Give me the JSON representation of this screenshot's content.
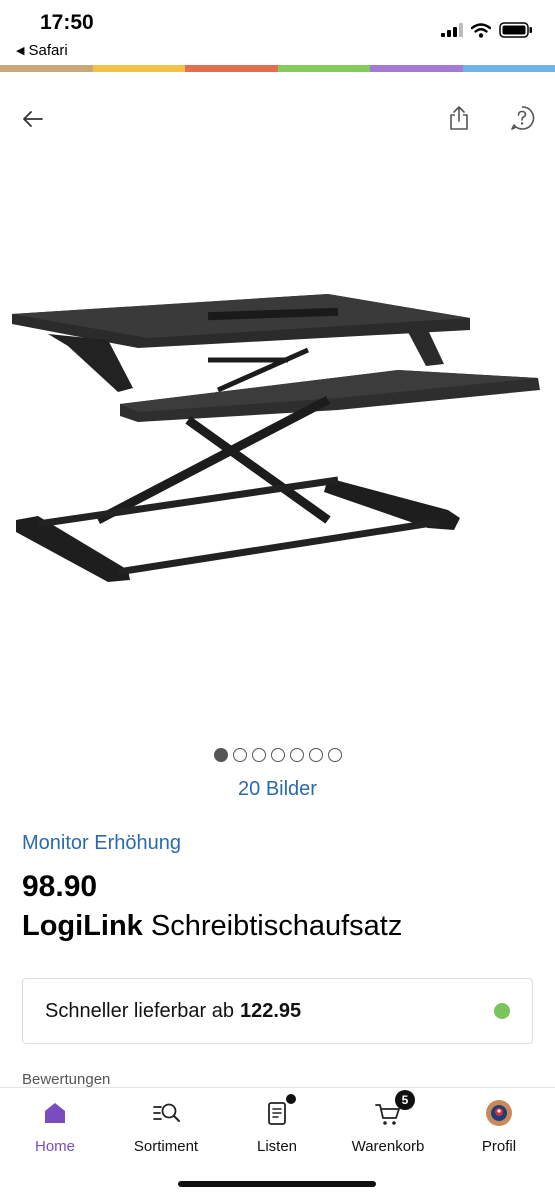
{
  "status_bar": {
    "time": "17:50",
    "back_app": "Safari"
  },
  "color_stripe": [
    "#c9a87c",
    "#f0c24a",
    "#e0704f",
    "#86c95d",
    "#a57bd1",
    "#6fb3e8"
  ],
  "header": {
    "back_icon": "arrow-left-icon",
    "share_icon": "share-icon",
    "help_icon": "help-icon"
  },
  "gallery": {
    "dot_count": 7,
    "active_dot": 0,
    "images_link": "20 Bilder"
  },
  "product": {
    "category": "Monitor Erhöhung",
    "price": "98.90",
    "brand": "LogiLink",
    "name": "Schreibtischaufsatz"
  },
  "delivery": {
    "text": "Schneller lieferbar ab",
    "price": "122.95",
    "status_color": "#7bc45c"
  },
  "reviews": {
    "label": "Bewertungen"
  },
  "bottom_nav": {
    "items": [
      {
        "label": "Home",
        "icon": "home-icon",
        "active": true
      },
      {
        "label": "Sortiment",
        "icon": "catalog-search-icon",
        "active": false
      },
      {
        "label": "Listen",
        "icon": "list-icon",
        "active": false
      },
      {
        "label": "Warenkorb",
        "icon": "cart-icon",
        "active": false,
        "badge": "5"
      },
      {
        "label": "Profil",
        "icon": "avatar-icon",
        "active": false
      }
    ]
  },
  "accent_color": "#7b4bc0",
  "link_color": "#2a6bb0"
}
